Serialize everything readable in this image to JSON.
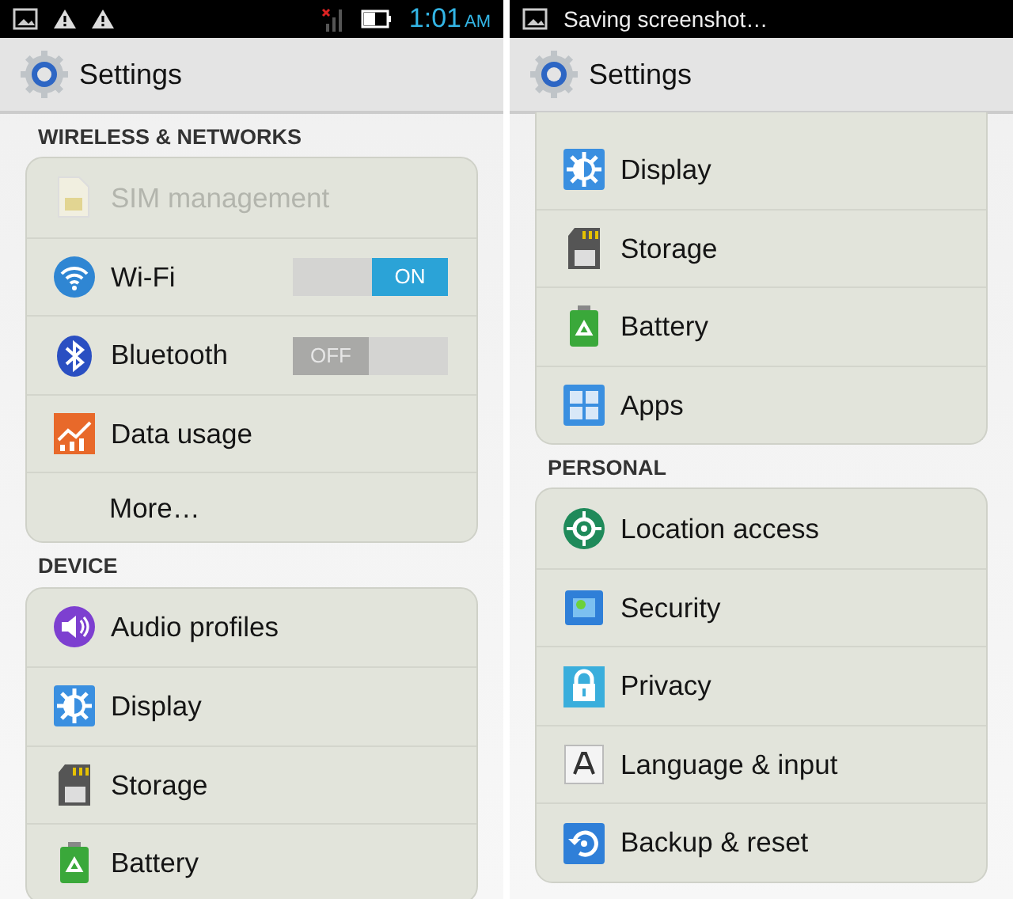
{
  "screens": [
    {
      "status_bar": {
        "kind": "icons",
        "time": "1:01",
        "ampm": "AM"
      },
      "title": "Settings",
      "sections": [
        {
          "header": "WIRELESS & NETWORKS",
          "items": [
            {
              "kind": "sim",
              "label": "SIM management",
              "disabled": true
            },
            {
              "kind": "wifi",
              "label": "Wi-Fi",
              "disabled": false,
              "switch": {
                "on": true,
                "label": "ON"
              }
            },
            {
              "kind": "bluetooth",
              "label": "Bluetooth",
              "disabled": false,
              "switch": {
                "on": false,
                "label": "OFF"
              }
            },
            {
              "kind": "data",
              "label": "Data usage",
              "disabled": false
            },
            {
              "label": "More…",
              "disabled": false
            }
          ]
        },
        {
          "header": "DEVICE",
          "items": [
            {
              "kind": "audio",
              "label": "Audio profiles",
              "disabled": false
            },
            {
              "kind": "display",
              "label": "Display",
              "disabled": false
            },
            {
              "kind": "storage",
              "label": "Storage",
              "disabled": false
            },
            {
              "kind": "battery",
              "label": "Battery",
              "disabled": false
            }
          ]
        }
      ]
    },
    {
      "status_bar": {
        "kind": "notification",
        "text": "Saving screenshot…"
      },
      "title": "Settings",
      "sections": [
        {
          "items": [
            {
              "kind": "display",
              "label": "Display",
              "disabled": false
            },
            {
              "kind": "storage",
              "label": "Storage",
              "disabled": false
            },
            {
              "kind": "battery",
              "label": "Battery",
              "disabled": false
            },
            {
              "kind": "apps",
              "label": "Apps",
              "disabled": false
            }
          ]
        },
        {
          "header": "PERSONAL",
          "items": [
            {
              "kind": "location",
              "label": "Location access",
              "disabled": false
            },
            {
              "kind": "security",
              "label": "Security",
              "disabled": false
            },
            {
              "kind": "privacy",
              "label": "Privacy",
              "disabled": false
            },
            {
              "kind": "language",
              "label": "Language & input",
              "disabled": false
            },
            {
              "kind": "backup",
              "label": "Backup & reset",
              "disabled": false
            }
          ]
        }
      ]
    }
  ]
}
